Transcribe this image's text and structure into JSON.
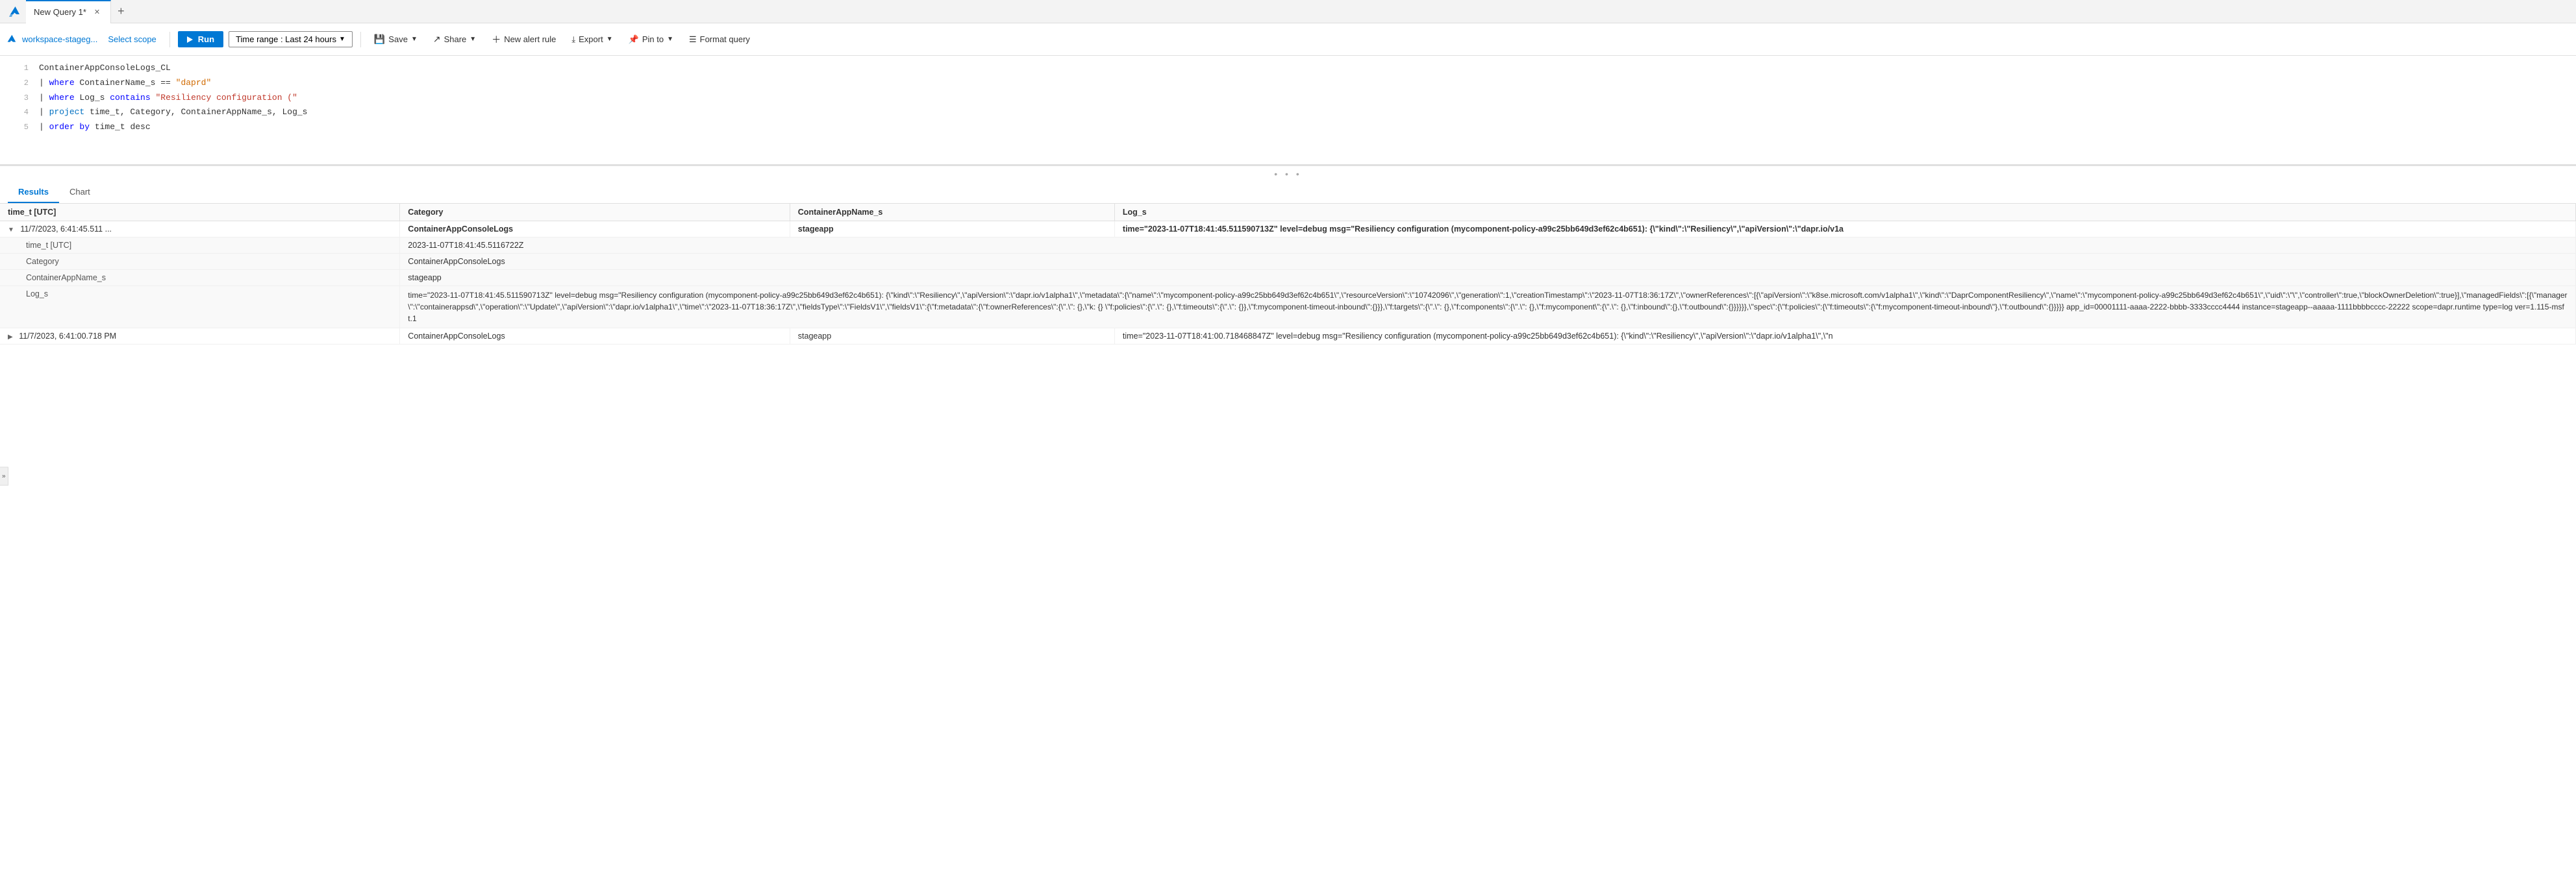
{
  "app": {
    "name": "Azure Monitor Logs"
  },
  "tabs": [
    {
      "label": "New Query 1*",
      "active": true,
      "modified": true
    }
  ],
  "tab_add_label": "+",
  "toolbar": {
    "workspace_label": "workspace-stageg...",
    "select_scope_label": "Select scope",
    "run_label": "Run",
    "time_range_label": "Time range : Last 24 hours",
    "save_label": "Save",
    "share_label": "Share",
    "new_alert_rule_label": "New alert rule",
    "export_label": "Export",
    "pin_to_label": "Pin to",
    "format_query_label": "Format query"
  },
  "editor": {
    "lines": [
      {
        "num": 1,
        "text": "ContainerAppConsoleLogs_CL",
        "parts": [
          {
            "t": "ContainerAppConsoleLogs_CL",
            "cls": ""
          }
        ]
      },
      {
        "num": 2,
        "text": "| where ContainerName_s == \"daprd\"",
        "parts": [
          {
            "t": "| ",
            "cls": ""
          },
          {
            "t": "where",
            "cls": "kw-blue"
          },
          {
            "t": " ContainerName_s == ",
            "cls": ""
          },
          {
            "t": "\"daprd\"",
            "cls": "str-orange"
          }
        ]
      },
      {
        "num": 3,
        "text": "| where Log_s contains \"Resiliency configuration (\"",
        "parts": [
          {
            "t": "| ",
            "cls": ""
          },
          {
            "t": "where",
            "cls": "kw-blue"
          },
          {
            "t": " Log_s ",
            "cls": ""
          },
          {
            "t": "contains",
            "cls": "kw-blue"
          },
          {
            "t": " ",
            "cls": ""
          },
          {
            "t": "\"Resiliency configuration (\"",
            "cls": "str-red"
          }
        ]
      },
      {
        "num": 4,
        "text": "| project time_t, Category, ContainerAppName_s, Log_s",
        "parts": [
          {
            "t": "| ",
            "cls": ""
          },
          {
            "t": "project",
            "cls": "kw-light-blue"
          },
          {
            "t": " time_t, Category, ContainerAppName_s, Log_s",
            "cls": ""
          }
        ]
      },
      {
        "num": 5,
        "text": "| order by time_t desc",
        "parts": [
          {
            "t": "| ",
            "cls": ""
          },
          {
            "t": "order by",
            "cls": "kw-blue"
          },
          {
            "t": " time_t desc",
            "cls": ""
          }
        ]
      }
    ]
  },
  "results": {
    "tabs": [
      "Results",
      "Chart"
    ],
    "active_tab": "Results",
    "columns": [
      "time_t [UTC]",
      "Category",
      "ContainerAppName_s",
      "Log_s"
    ],
    "rows": [
      {
        "expanded": true,
        "time_t": "11/7/2023, 6:41:45.511 ...",
        "category": "ContainerAppConsoleLogs",
        "container_app": "stageapp",
        "log_s": "time=\"2023-11-07T18:41:45.511590713Z\" level=debug msg=\"Resiliency configuration (mycomponent-policy-a99c25bb649d3ef62c4b651): {\\\"kind\\\":\\\"Resiliency\\\",\\\"apiVersion\\\":\\\"dapr.io/v1a",
        "expand_fields": [
          {
            "label": "time_t [UTC]",
            "value": "2023-11-07T18:41:45.5116722Z"
          },
          {
            "label": "Category",
            "value": "ContainerAppConsoleLogs"
          },
          {
            "label": "ContainerAppName_s",
            "value": "stageapp"
          },
          {
            "label": "Log_s",
            "value": "time=\"2023-11-07T18:41:45.511590713Z\" level=debug msg=\"Resiliency configuration (mycomponent-policy-a99c25bb649d3ef62c4b651): {\\\"kind\\\":\\\"Resiliency\\\",\\\"apiVersion\\\":\\\"dapr.io/v1alpha1\\\",\\\"metadata\\\":{\\\"name\\\":\\\"mycomponent-policy-a99c25bb649d3ef62c4b651\\\",\\\"resourceVersion\\\":\\\"10742096\\\",\\\"generation\\\":1,\\\"creationTimestamp\\\":\\\"2023-11-07T18:36:17Z\\\",\\\"ownerReferences\\\":[{\\\"apiVersion\\\":\\\"k8se.microsoft.com/v1alpha1\\\",\\\"kind\\\":\\\"DaprComponentResiliency\\\",\\\"name\\\":\\\"mycomponent-policy-a99c25bb649d3ef62c4b651\\\",\\\"uid\\\":\\\"\\\",\\\"controller\\\":true,\\\"blockOwnerDeletion\\\":true}],\\\"managedFields\\\":[{\\\"manager\\\":\\\"containerappsd\\\",\\\"operation\\\":\\\"Update\\\",\\\"apiVersion\\\":\\\"dapr.io/v1alpha1\\\",\\\"time\\\":\\\"2023-11-07T18:36:17Z\\\",\\\"fieldsType\\\":\\\"FieldsV1\\\",\\\"fieldsV1\\\":{\\\"f:metadata\\\":{\\\"f:ownerReferences\\\":{\\\".\\\": {},\\\"k: {} \\\"f:policies\\\":{\\\".\\\": {},\\\"f:timeouts\\\":{\\\".\\\": {}},\\\"f:mycomponent-timeout-inbound\\\":{}}},\\\"f:targets\\\":{\\\".\\\": {},\\\"f:components\\\":{\\\".\\\": {},\\\"f:mycomponent\\\":{\\\".\\\": {},\\\"f:inbound\\\":{},\\\"f:outbound\\\":{}}}}}},\\\"spec\\\":{\\\"f:policies\\\":{\\\"f:timeouts\\\":{\\\"f:mycomponent-timeout-inbound\\\"},\\\"f:outbound\\\":{}}}}} app_id=00001111-aaaa-2222-bbbb-3333cccc4444 instance=stageapp--aaaaa-1111bbbbcccc-22222 scope=dapr.runtime type=log ver=1.115-msft.1"
          }
        ]
      },
      {
        "expanded": false,
        "time_t": "11/7/2023, 6:41:00.718 PM",
        "category": "ContainerAppConsoleLogs",
        "container_app": "stageapp",
        "log_s": "time=\"2023-11-07T18:41:00.718468847Z\" level=debug msg=\"Resiliency configuration (mycomponent-policy-a99c25bb649d3ef62c4b651): {\\\"kind\\\":\\\"Resiliency\\\",\\\"apiVersion\\\":\\\"dapr.io/v1alpha1\\\",\\\"n"
      }
    ]
  }
}
